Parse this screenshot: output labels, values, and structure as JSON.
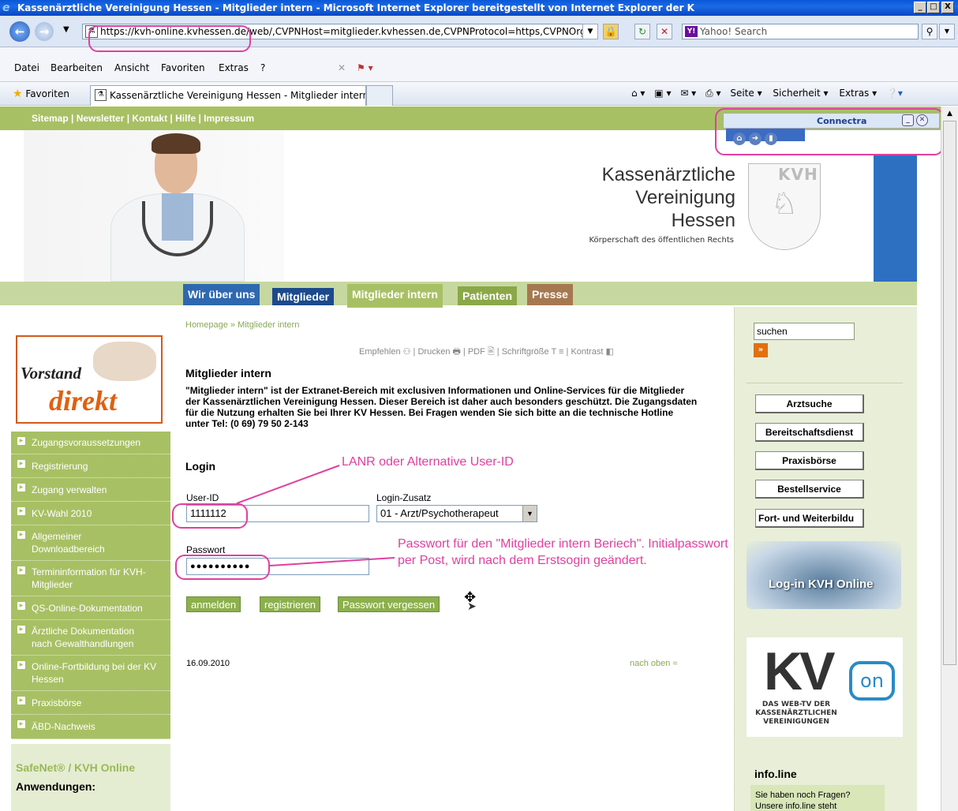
{
  "window": {
    "title": "Kassenärztliche Vereinigung Hessen - Mitglieder intern - Microsoft Internet Explorer bereitgestellt von Internet Explorer der K",
    "buttons": {
      "minimize": "_",
      "maximize": "□",
      "close": "X"
    }
  },
  "address": {
    "url": "https://kvh-online.kvhessen.de/web/,CVPNHost=mitglieder.kvhessen.de,CVPNProtocol=https,CVPNOrg=fu",
    "search_placeholder": "Yahoo! Search"
  },
  "menu": [
    "Datei",
    "Bearbeiten",
    "Ansicht",
    "Favoriten",
    "Extras",
    "?"
  ],
  "favorites": {
    "label": "Favoriten",
    "tab_title": "Kassenärztliche Vereinigung Hessen - Mitglieder intern",
    "cmd_seite": "Seite ▾",
    "cmd_sicherheit": "Sicherheit ▾",
    "cmd_extras": "Extras ▾"
  },
  "site": {
    "toplinks": "Sitemap | Newsletter | Kontakt | Hilfe | Impressum",
    "connectra": "Connectra",
    "kv_title_1": "Kassenärztliche",
    "kv_title_2": "Vereinigung",
    "kv_title_3": "Hessen",
    "kv_subtitle": "Körperschaft des öffentlichen Rechts",
    "kvh_logo": "KVH"
  },
  "tabs": [
    {
      "label": "Wir über uns",
      "color": "#2e68b0"
    },
    {
      "label": "Mitglieder",
      "color": "#1c4a8c"
    },
    {
      "label": "Mitglieder intern",
      "color": "#a8c064"
    },
    {
      "label": "Patienten",
      "color": "#8aa848"
    },
    {
      "label": "Presse",
      "color": "#a67850"
    }
  ],
  "left": {
    "vorstand_1": "Vorstand",
    "vorstand_2": "direkt",
    "nav": [
      "Zugangsvoraussetzungen",
      "Registrierung",
      "Zugang verwalten",
      "KV-Wahl 2010",
      "Allgemeiner Downloadbereich",
      "Termininformation für KVH-Mitglieder",
      "QS-Online-Dokumentation",
      "Ärztliche Dokumentation nach Gewalthandlungen",
      "Online-Fortbildung bei der KV Hessen",
      "Praxisbörse",
      "ÄBD-Nachweis"
    ],
    "safenet": "SafeNet® / KVH Online",
    "anwendungen": "Anwendungen:"
  },
  "main": {
    "breadcrumb_home": "Homepage",
    "breadcrumb_sep": "»",
    "breadcrumb_current": "Mitglieder intern",
    "tools": "Empfehlen ⚇ | Drucken 🖶 | PDF 🖹 | Schriftgröße T ≡ | Kontrast ◧",
    "heading": "Mitglieder intern",
    "intro": "\"Mitglieder intern\" ist der Extranet-Bereich mit exclusiven Informationen und Online-Services für die Mitglieder der Kassenärztlichen Vereinigung Hessen. Dieser Bereich ist daher auch besonders geschützt. Die Zugangsdaten für die Nutzung erhalten Sie bei Ihrer KV Hessen. Bei Fragen wenden Sie sich bitte an die technische Hotline unter Tel: (0 69) 79 50 2-143",
    "login_heading": "Login",
    "userid_label": "User-ID",
    "userid_value": "1111112",
    "zusatz_label": "Login-Zusatz",
    "zusatz_value": "01 - Arzt/Psychotherapeut",
    "password_label": "Passwort",
    "password_value": "●●●●●●●●●●",
    "btn_anmelden": "anmelden",
    "btn_registrieren": "registrieren",
    "btn_vergessen": "Passwort vergessen",
    "date": "16.09.2010",
    "nach_oben": "nach oben ≈"
  },
  "annotations": {
    "note_userid": "LANR oder Alternative User-ID",
    "note_password": "Passwort für den \"Mitglieder intern Beriech\". Initialpasswort per Post, wird nach dem Erstsogin geändert."
  },
  "right": {
    "search_value": "suchen",
    "search_go": "»",
    "buttons": [
      "Arztsuche",
      "Bereitschaftsdienst",
      "Praxisbörse",
      "Bestellservice",
      "Fort- und Weiterbildu"
    ],
    "stick_label": "Log-in KVH Online",
    "kvon_kv": "KV",
    "kvon_on": "on",
    "kvon_sub": "DAS WEB-TV DER KASSENÄRZTLICHEN VEREINIGUNGEN",
    "infoline": "info.line",
    "infobox": "Sie haben noch Fragen? Unsere info.line steht"
  }
}
